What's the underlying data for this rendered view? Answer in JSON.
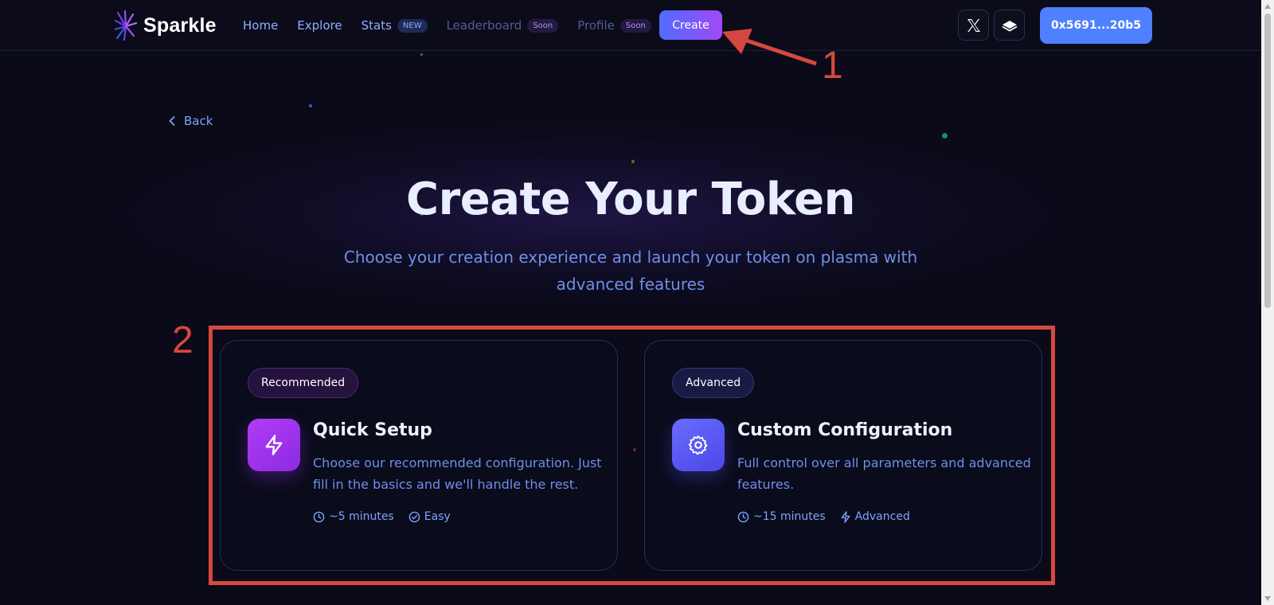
{
  "header": {
    "logo_text": "Sparkle",
    "nav": [
      {
        "label": "Home"
      },
      {
        "label": "Explore"
      },
      {
        "label": "Stats",
        "badge": "NEW"
      },
      {
        "label": "Leaderboard",
        "badge": "Soon"
      },
      {
        "label": "Profile",
        "badge": "Soon"
      }
    ],
    "create_label": "Create",
    "wallet_label": "0x5691...20b5"
  },
  "back_label": "Back",
  "hero": {
    "title": "Create Your Token",
    "subtitle": "Choose your creation experience and launch your token on plasma with advanced features"
  },
  "cards": [
    {
      "badge": "Recommended",
      "title": "Quick Setup",
      "description": "Choose our recommended configuration. Just fill in the basics and we'll handle the rest.",
      "time": "~5 minutes",
      "level": "Easy",
      "icon": "lightning-icon"
    },
    {
      "badge": "Advanced",
      "title": "Custom Configuration",
      "description": "Full control over all parameters and advanced features.",
      "time": "~15 minutes",
      "level": "Advanced",
      "icon": "gear-icon"
    }
  ],
  "annotations": {
    "one": "1",
    "two": "2"
  },
  "colors": {
    "background": "#0a0a18",
    "accent_blue": "#4e80ff",
    "accent_purple": "#a149f5",
    "annotation_red": "#d6483f"
  }
}
